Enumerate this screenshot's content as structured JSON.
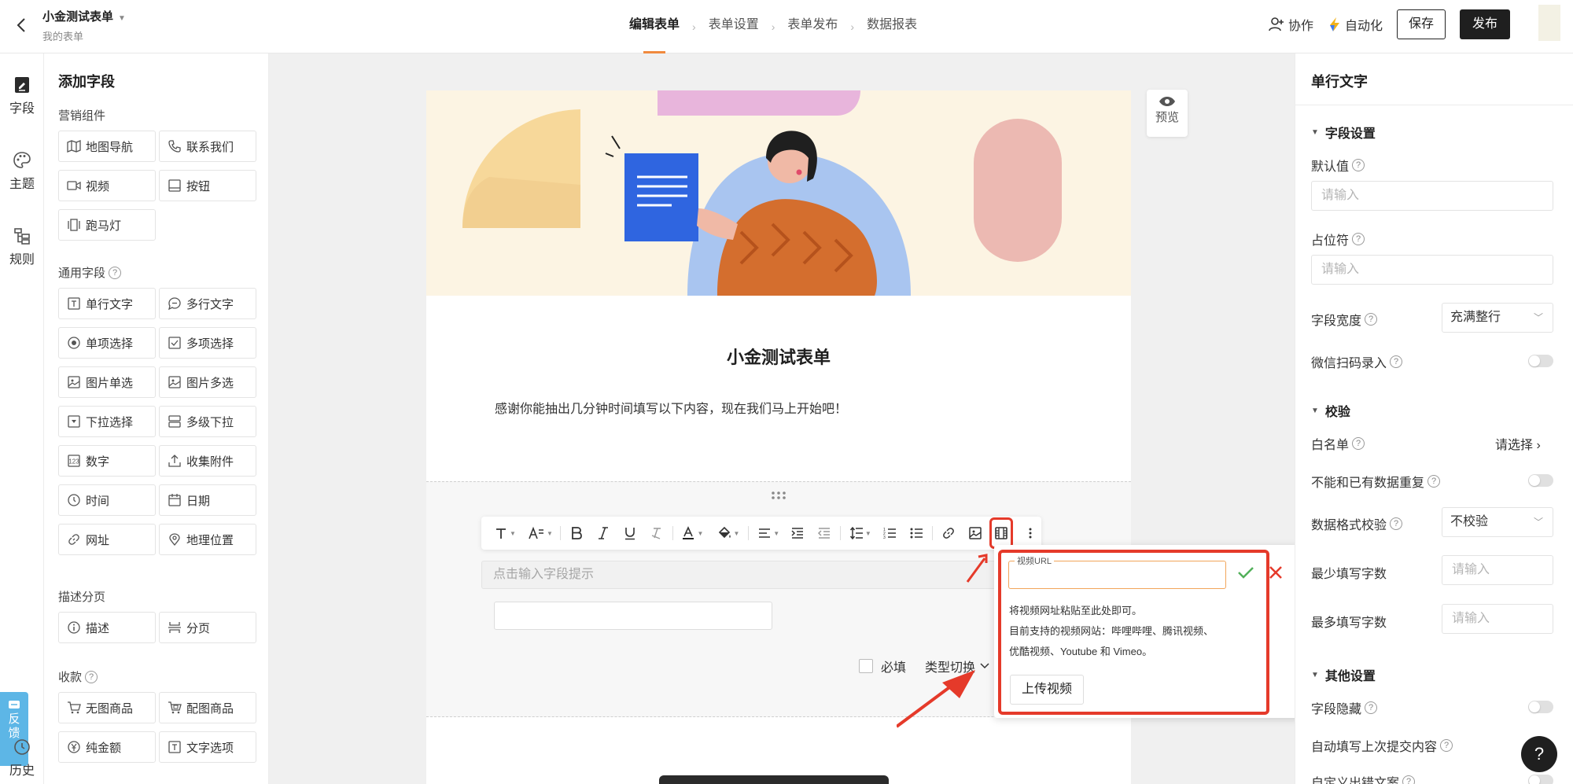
{
  "header": {
    "form_title": "小金测试表单",
    "form_subtitle": "我的表单",
    "steps": [
      "编辑表单",
      "表单设置",
      "表单发布",
      "数据报表"
    ],
    "collab_label": "协作",
    "automation_label": "自动化",
    "save_label": "保存",
    "publish_label": "发布"
  },
  "rail": {
    "items": [
      "字段",
      "主题",
      "规则"
    ],
    "feedback_label": "反馈",
    "history_label": "历史"
  },
  "left_panel": {
    "title": "添加字段",
    "sections": [
      {
        "title": "营销组件",
        "items": [
          "地图导航",
          "联系我们",
          "视频",
          "按钮",
          "跑马灯"
        ]
      },
      {
        "title": "通用字段",
        "items": [
          "单行文字",
          "多行文字",
          "单项选择",
          "多项选择",
          "图片单选",
          "图片多选",
          "下拉选择",
          "多级下拉",
          "数字",
          "收集附件",
          "时间",
          "日期",
          "网址",
          "地理位置"
        ]
      },
      {
        "title": "描述分页",
        "items": [
          "描述",
          "分页"
        ]
      },
      {
        "title": "收款",
        "items": [
          "无图商品",
          "配图商品",
          "纯金额",
          "文字选项"
        ]
      }
    ]
  },
  "canvas": {
    "preview_label": "预览",
    "form_title": "小金测试表单",
    "form_desc": "感谢你能抽出几分钟时间填写以下内容，现在我们马上开始吧！",
    "hint_placeholder": "点击输入字段提示",
    "required_label": "必填",
    "type_switch_label": "类型切换"
  },
  "video_popup": {
    "legend": "视频URL",
    "line1": "将视频网址粘贴至此处即可。",
    "line2": "目前支持的视频网站：哔哩哔哩、腾讯视频、优酷视频、Youtube 和 Vimeo。",
    "upload_label": "上传视频"
  },
  "right_panel": {
    "title": "单行文字",
    "field_settings": "字段设置",
    "default_value": "默认值",
    "default_placeholder": "请输入",
    "placeholder_label": "占位符",
    "placeholder_placeholder": "请输入",
    "width_label": "字段宽度",
    "width_value": "充满整行",
    "wechat_scan": "微信扫码录入",
    "validation": "校验",
    "whitelist": "白名单",
    "whitelist_choose": "请选择",
    "no_dup": "不能和已有数据重复",
    "format_label": "数据格式校验",
    "format_value": "不校验",
    "min_chars": "最少填写字数",
    "min_placeholder": "请输入",
    "max_chars": "最多填写字数",
    "max_placeholder": "请输入",
    "other_settings": "其他设置",
    "hide_field": "字段隐藏",
    "auto_fill": "自动填写上次提交内容",
    "custom_error": "自定义出错文案"
  },
  "colors": {
    "accent": "#f08a3e",
    "highlight": "#e53a2a",
    "feedback": "#5db6e6",
    "dark_button": "#1f1f1f"
  }
}
